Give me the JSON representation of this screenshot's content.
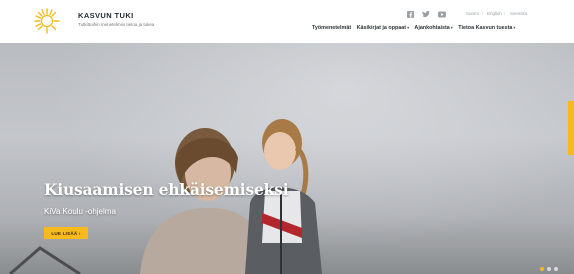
{
  "brand": {
    "name": "KASVUN TUKI",
    "tagline": "Tutkittuihin menetelmiin tietoa ja tukea"
  },
  "social": [
    "facebook-icon",
    "twitter-icon",
    "youtube-icon"
  ],
  "languages": [
    "Suomi",
    "English",
    "Svenska"
  ],
  "nav": {
    "items": [
      {
        "label": "Työmenetelmät",
        "dropdown": false
      },
      {
        "label": "Käsikirjat ja oppaat",
        "dropdown": true
      },
      {
        "label": "Ajankohtaista",
        "dropdown": true
      },
      {
        "label": "Tietoa Kasvun tuesta",
        "dropdown": true
      }
    ]
  },
  "hero": {
    "title": "Kiusaamisen ehkäisemiseksi",
    "subtitle": "KiVa Koulu -ohjelma",
    "cta": "LUE LISÄÄ ›"
  },
  "slider": {
    "count": 3,
    "active": 1
  },
  "colors": {
    "accent": "#f6b91e",
    "text": "#2d3439"
  }
}
